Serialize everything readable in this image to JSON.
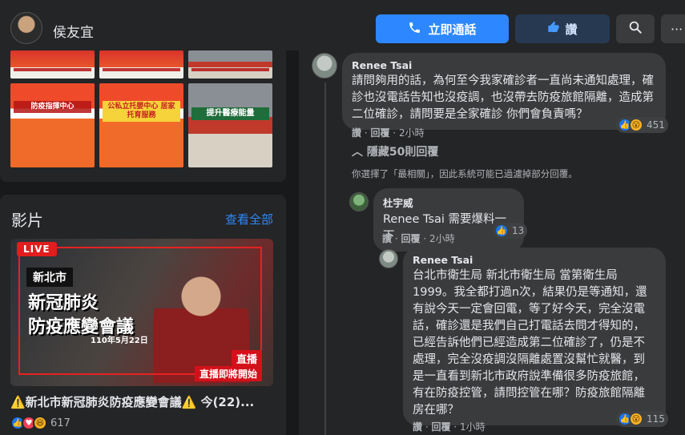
{
  "header": {
    "page_name": "侯友宜",
    "call_button": "立即通話",
    "like_button": "讚",
    "more_label": "···"
  },
  "photos": {
    "thumbs": [
      {
        "label": ""
      },
      {
        "label": ""
      },
      {
        "label": ""
      },
      {
        "label": "防疫指揮中心"
      },
      {
        "label": "公私立托嬰中心 居家托育服務"
      },
      {
        "label": "提升醫療能量"
      }
    ]
  },
  "videos": {
    "title": "影片",
    "see_all": "查看全部",
    "live_badge": "LIVE",
    "thumb_city": "新北市",
    "thumb_title_1": "新冠肺炎",
    "thumb_title_2": "防疫應變會議",
    "thumb_date": "110年5月22日",
    "thumb_live_label": "直播",
    "thumb_coming": "直播即將開始",
    "caption": "⚠️新北市新冠肺炎防疫應變會議⚠️ 今(22)...",
    "reaction_count": "617"
  },
  "comments": {
    "c1": {
      "name": "Renee Tsai",
      "text": "請問夠用的話，為何至今我家確診者一直尚未通知處理，確診也沒電話告知也沒疫調，也沒帶去防疫旅館隔離，造成第二位確診，請問要是全家確診 你們會負責嗎？",
      "like": "讚",
      "reply": "回覆",
      "time": "2小時",
      "reactions": "451"
    },
    "hidden_replies": "隱藏50則回覆",
    "filter_note": "你選擇了「最相關」，因此系統可能已過濾掉部分回覆。",
    "c2": {
      "name": "杜宇威",
      "text": "Renee Tsai 需要爆料一下",
      "like": "讚",
      "reply": "回覆",
      "time": "2小時",
      "reactions": "13"
    },
    "c3": {
      "name": "Renee Tsai",
      "text": "台北市衛生局 新北市衛生局 當第衛生局 1999。我全都打過n次，結果仍是等通知，還有說今天一定會回電，等了好今天，完全沒電話，確診還是我們自己打電話去問才得知的，已經告訴他們已經造成第二位確診了，仍是不處理，完全沒疫調沒隔離處置沒幫忙就醫，到是一直看到新北市政府說準備很多防疫旅館，有在防疫控管，請問控管在哪？防疫旅館隔離房在哪？",
      "like": "讚",
      "reply": "回覆",
      "time": "1小時",
      "reactions": "115"
    }
  },
  "colors": {
    "accent": "#2d88ff",
    "bg": "#18191a",
    "card": "#242526",
    "bubble": "#3a3b3c"
  }
}
